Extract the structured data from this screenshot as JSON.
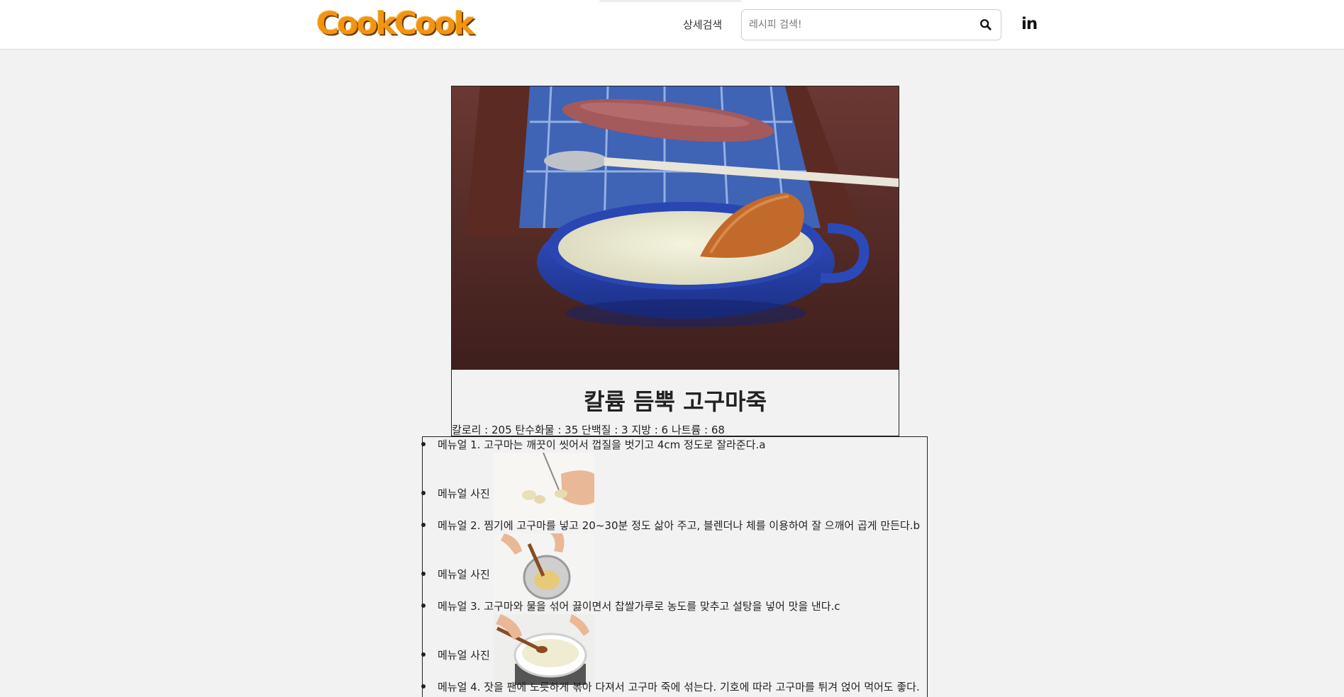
{
  "header": {
    "logo_text": "CookCook",
    "detail_search_label": "상세검색",
    "search_placeholder": "레시피 검색!",
    "search_icon": "search-icon",
    "social_icon": "linkedin-icon",
    "social_text": "in"
  },
  "recipe": {
    "title": "칼륨 듬뿍 고구마죽",
    "nutrition": "칼로리 : 205 탄수화물 : 35 단백질 : 3 지방 : 6 나트륨 : 68",
    "hero_image": "sweet-potato-porridge-photo"
  },
  "manual": {
    "photo_label": "메뉴얼 사진",
    "steps": [
      {
        "text": "메뉴얼 1. 고구마는 깨끗이 씻어서 껍질을 벗기고 4cm 정도로 잘라준다.a",
        "photo": "step-1-photo"
      },
      {
        "text": "메뉴얼 2. 찜기에 고구마를 넣고 20~30분 정도 삶아 주고, 블렌더나 체를 이용하여 잘 으깨어 곱게 만든다.b",
        "photo": "step-2-photo"
      },
      {
        "text": "메뉴얼 3. 고구마와 물을 섞어 끓이면서 찹쌀가루로 농도를 맞추고 설탕을 넣어 맛을 낸다.c",
        "photo": "step-3-photo"
      },
      {
        "text": "메뉴얼 4. 잣을 팬에 노릇하게 볶아 다져서 고구마 죽에 섞는다. 기호에 따라 고구마를 튀겨 얹어 먹어도 좋다.",
        "photo": ""
      }
    ]
  },
  "colors": {
    "background": "#f2f2f2",
    "logo_orange": "#f29411",
    "bowl_blue": "#2c49b8",
    "table_wood": "#5a2e2a"
  }
}
